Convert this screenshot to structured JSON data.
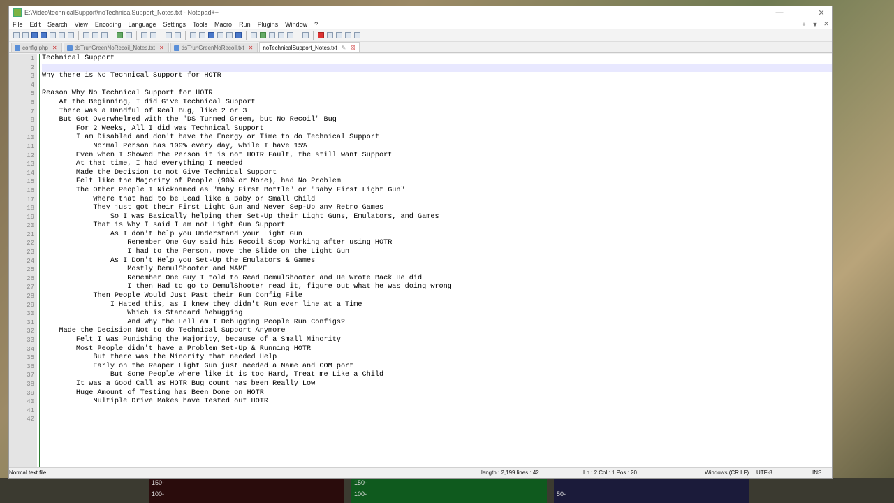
{
  "window": {
    "title": "E:\\Video\\technicalSupport\\noTechnicalSupport_Notes.txt - Notepad++",
    "minimize": "—",
    "maximize": "☐",
    "close": "✕"
  },
  "menu": {
    "items": [
      "File",
      "Edit",
      "Search",
      "View",
      "Encoding",
      "Language",
      "Settings",
      "Tools",
      "Macro",
      "Run",
      "Plugins",
      "Window",
      "?"
    ],
    "right": [
      "+",
      "▼",
      "✕"
    ]
  },
  "tabs": [
    {
      "label": "config.php",
      "active": false
    },
    {
      "label": "dsTrunGreenNoRecoil_Notes.txt",
      "active": false
    },
    {
      "label": "dsTrunGreenNoRecoil.txt",
      "active": false
    },
    {
      "label": "noTechnicalSupport_Notes.txt",
      "active": true
    }
  ],
  "editor": {
    "current_line": 2,
    "lines": [
      "Technical Support",
      "",
      "Why there is No Technical Support for HOTR",
      "",
      "Reason Why No Technical Support for HOTR",
      "    At the Beginning, I did Give Technical Support",
      "    There was a Handful of Real Bug, like 2 or 3",
      "    But Got Overwhelmed with the \"DS Turned Green, but No Recoil\" Bug",
      "        For 2 Weeks, All I did was Technical Support",
      "        I am Disabled and don't have the Energy or Time to do Technical Support",
      "            Normal Person has 100% every day, while I have 15%",
      "        Even when I Showed the Person it is not HOTR Fault, the still want Support",
      "        At that time, I had everything I needed",
      "        Made the Decision to not Give Technical Support",
      "        Felt like the Majority of People (90% or More), had No Problem",
      "        The Other People I Nicknamed as \"Baby First Bottle\" or \"Baby First Light Gun\"",
      "            Where that had to be Lead like a Baby or Small Child",
      "            They just got their First Light Gun and Never Sep-Up any Retro Games",
      "                So I was Basically helping them Set-Up their Light Guns, Emulators, and Games",
      "            That is Why I said I am not Light Gun Support",
      "                As I don't help you Understand your Light Gun",
      "                    Remember One Guy said his Recoil Stop Working after using HOTR",
      "                    I had to the Person, move the Slide on the Light Gun",
      "                As I Don't Help you Set-Up the Emulators & Games",
      "                    Mostly DemulShooter and MAME",
      "                    Remember One Guy I told to Read DemulShooter and He Wrote Back He did",
      "                    I then Had to go to DemulShooter read it, figure out what he was doing wrong",
      "            Then People Would Just Past their Run Config File",
      "                I Hated this, as I knew they didn't Run ever line at a Time",
      "                    Which is Standard Debugging",
      "                    And Why the Hell am I Debugging People Run Configs?",
      "    Made the Decision Not to do Technical Support Anymore",
      "        Felt I was Punishing the Majority, because of a Small Minority",
      "        Most People didn't have a Problem Set-Up & Running HOTR",
      "            But there was the Minority that needed Help",
      "            Early on the Reaper Light Gun just needed a Name and COM port",
      "                But Some People where like it is too Hard, Treat me Like a Child",
      "        It was a Good Call as HOTR Bug count has been Really Low",
      "        Huge Amount of Testing has Been Done on HOTR",
      "            Multiple Drive Makes have Tested out HOTR",
      "",
      ""
    ]
  },
  "status": {
    "type": "Normal text file",
    "length": "length : 2,199    lines : 42",
    "position": "Ln : 2    Col : 1    Pos : 20",
    "eol": "Windows (CR LF)",
    "encoding": "UTF-8",
    "mode": "INS"
  },
  "background": {
    "chart1_label": "150-",
    "chart1_label2": "100-",
    "chart2_label": "150-",
    "chart2_label2": "100-",
    "chart3_label": "50-"
  }
}
